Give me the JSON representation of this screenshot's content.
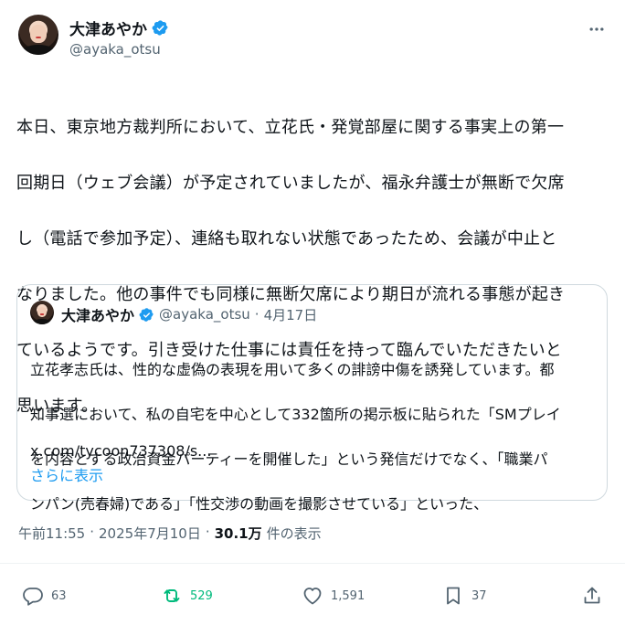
{
  "author": {
    "name": "大津あやか",
    "handle": "@ayaka_otsu"
  },
  "tweet": {
    "lines": [
      "本日、東京地方裁判所において、立花氏・発覚部屋に関する事実上の第一",
      "回期日（ウェブ会議）が予定されていましたが、福永弁護士が無断で欠席",
      "し（電話で参加予定）、連絡も取れない状態であったため、会議が中止と",
      "なりました。他の事件でも同様に無断欠席により期日が流れる事態が起き",
      "ているようです。引き受けた仕事には責任を持って臨んでいただきたいと",
      "思います。"
    ]
  },
  "quote": {
    "name": "大津あやか",
    "handle": "@ayaka_otsu",
    "separator": "·",
    "date": "4月17日",
    "lines": [
      "立花孝志氏は、性的な虚偽の表現を用いて多くの誹謗中傷を誘発しています。都",
      "知事選において、私の自宅を中心として332箇所の掲示板に貼られた「SMプレイ",
      "を内容とする政治資金パーティーを開催した」という発信だけでなく、「職業パ",
      "ンパン(売春婦)である」「性交渉の動画を撮影させている」といった、"
    ],
    "link": "x.com/tycoon737308/s...",
    "show_more": "さらに表示"
  },
  "meta": {
    "time": "午前11:55",
    "sep1": "·",
    "date": "2025年7月10日",
    "sep2": "·",
    "views": "30.1万",
    "views_label": "件の表示"
  },
  "actions": {
    "replies": "63",
    "reposts": "529",
    "likes": "1,591",
    "bookmarks": "37"
  },
  "colors": {
    "accent": "#1d9bf0",
    "repost": "#00ba7c",
    "muted": "#536471"
  }
}
